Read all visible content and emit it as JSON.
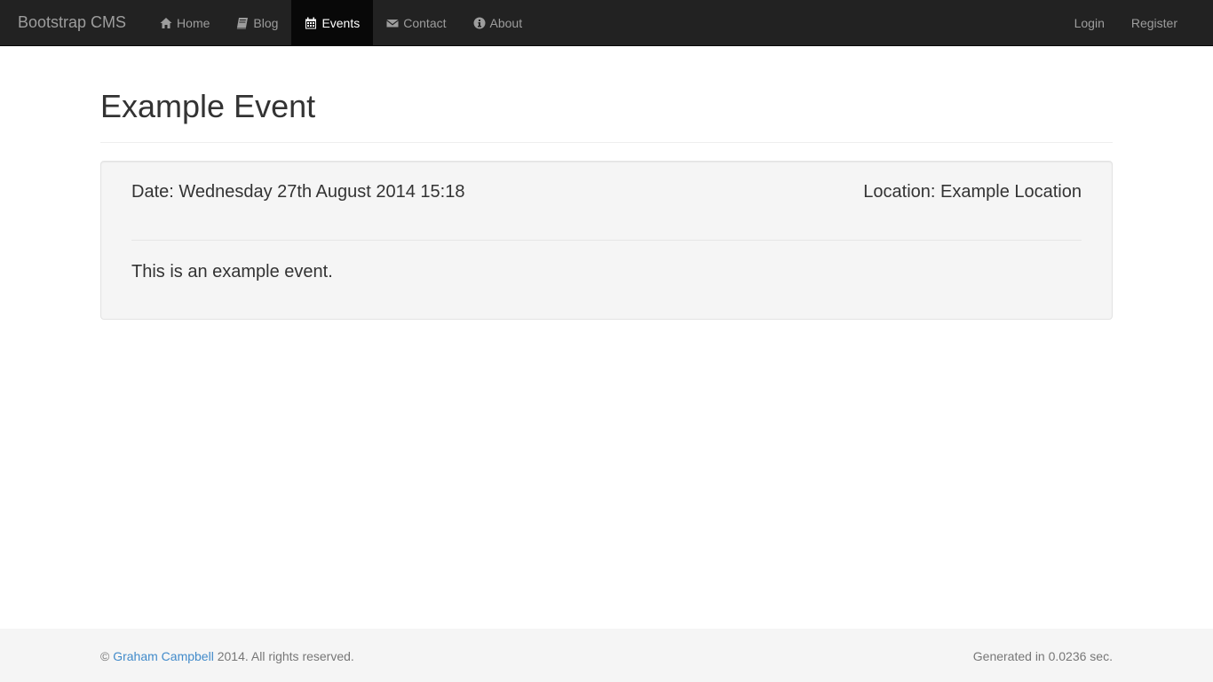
{
  "navbar": {
    "brand": "Bootstrap CMS",
    "items": [
      {
        "label": "Home",
        "icon": "home-icon"
      },
      {
        "label": "Blog",
        "icon": "book-icon"
      },
      {
        "label": "Events",
        "icon": "calendar-icon",
        "active": true
      },
      {
        "label": "Contact",
        "icon": "envelope-icon"
      },
      {
        "label": "About",
        "icon": "info-icon"
      }
    ],
    "right": [
      {
        "label": "Login"
      },
      {
        "label": "Register"
      }
    ]
  },
  "page": {
    "title": "Example Event"
  },
  "event": {
    "date": "Date: Wednesday 27th August 2014 15:18",
    "location": "Location: Example Location",
    "body": "This is an example event."
  },
  "footer": {
    "copyright_symbol": "©",
    "author": "Graham Campbell",
    "rights": "2014. All rights reserved.",
    "generated": "Generated in 0.0236 sec."
  },
  "colors": {
    "navbar_bg": "#222222",
    "active_bg": "#080808",
    "link": "#428bca",
    "well_bg": "#f5f5f5"
  }
}
